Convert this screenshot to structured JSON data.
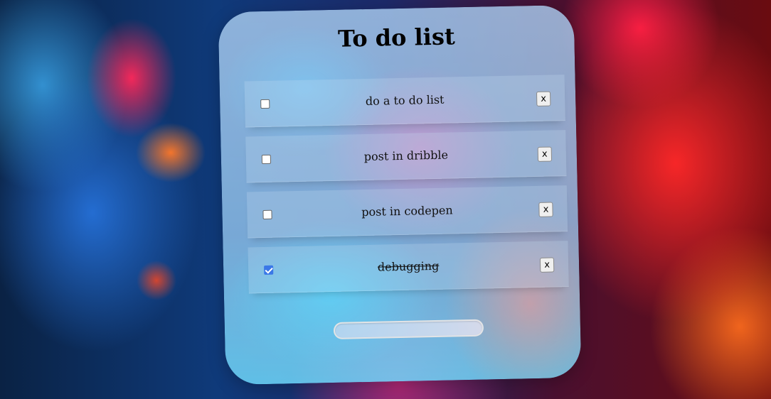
{
  "app": {
    "title": "To do list"
  },
  "todos": [
    {
      "text": "do a to do list",
      "checked": false,
      "delete_label": "x"
    },
    {
      "text": "post in dribble",
      "checked": false,
      "delete_label": "x"
    },
    {
      "text": "post in codepen",
      "checked": false,
      "delete_label": "x"
    },
    {
      "text": "debugging",
      "checked": true,
      "delete_label": "x"
    }
  ],
  "new_todo": {
    "value": "",
    "placeholder": ""
  },
  "colors": {
    "checkbox_checked": "#3b78e7",
    "title_text": "#000000"
  },
  "icons": {
    "delete": "x-icon",
    "checkbox": "checkbox-icon"
  }
}
